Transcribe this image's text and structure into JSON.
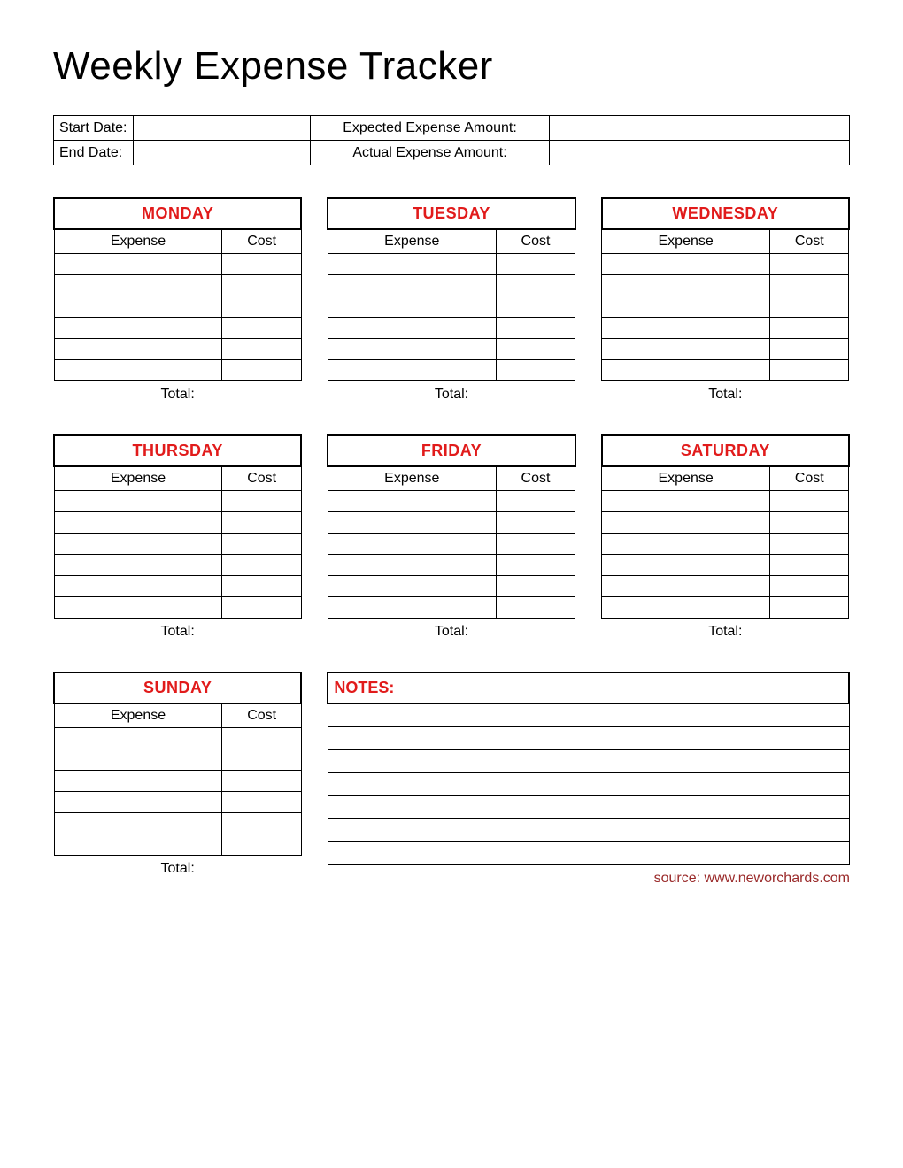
{
  "title": "Weekly Expense Tracker",
  "info": {
    "start_date_label": "Start Date:",
    "start_date_value": "",
    "end_date_label": "End Date:",
    "end_date_value": "",
    "expected_label": "Expected Expense Amount:",
    "expected_value": "",
    "actual_label": "Actual Expense Amount:",
    "actual_value": ""
  },
  "columns": {
    "expense": "Expense",
    "cost": "Cost"
  },
  "total_label": "Total:",
  "days": {
    "mon": "MONDAY",
    "tue": "TUESDAY",
    "wed": "WEDNESDAY",
    "thu": "THURSDAY",
    "fri": "FRIDAY",
    "sat": "SATURDAY",
    "sun": "SUNDAY"
  },
  "notes_label": "NOTES:",
  "source": "source: www.neworchards.com"
}
